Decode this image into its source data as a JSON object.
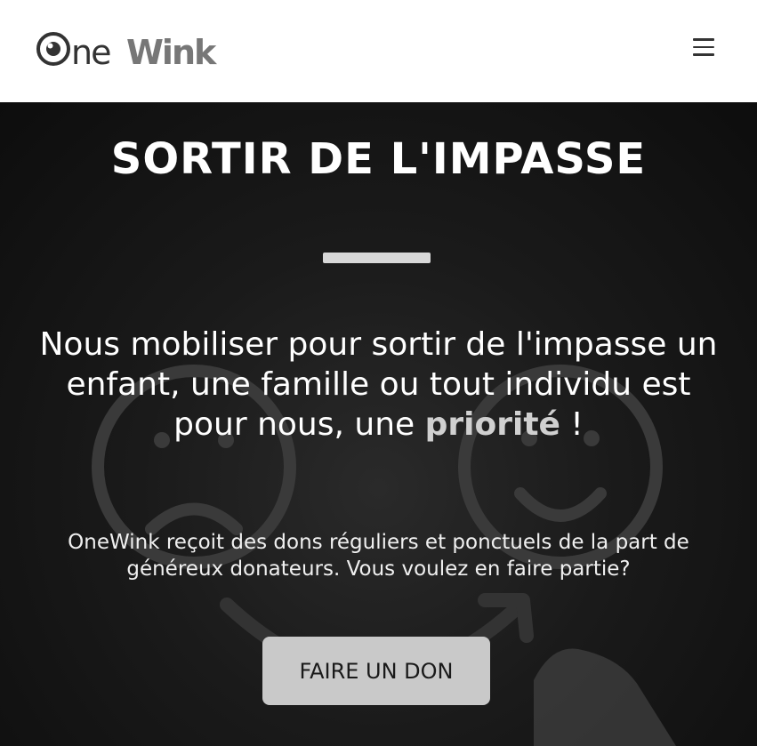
{
  "header": {
    "logo_text": "OneWink",
    "menu_icon": "hamburger-menu-icon"
  },
  "hero": {
    "title": "SORTIR DE L'IMPASSE",
    "headline_part1": "Nous mobiliser pour sortir de l'impasse un enfant, une famille ou tout individu est pour nous, une ",
    "headline_emphasis": "priorité",
    "headline_end": " !",
    "description": "OneWink reçoit des dons réguliers et ponctuels de la part de généreux donateurs. Vous voulez en faire partie?",
    "cta_label": "FAIRE UN DON",
    "background_icons": [
      "sad-face-icon",
      "happy-face-icon",
      "curved-arrow-icon",
      "hand-chalk-icon"
    ]
  },
  "colors": {
    "header_bg": "#ffffff",
    "hero_bg": "#111111",
    "button_bg": "#c9c9c9",
    "emphasis": "#d0d0d0"
  }
}
